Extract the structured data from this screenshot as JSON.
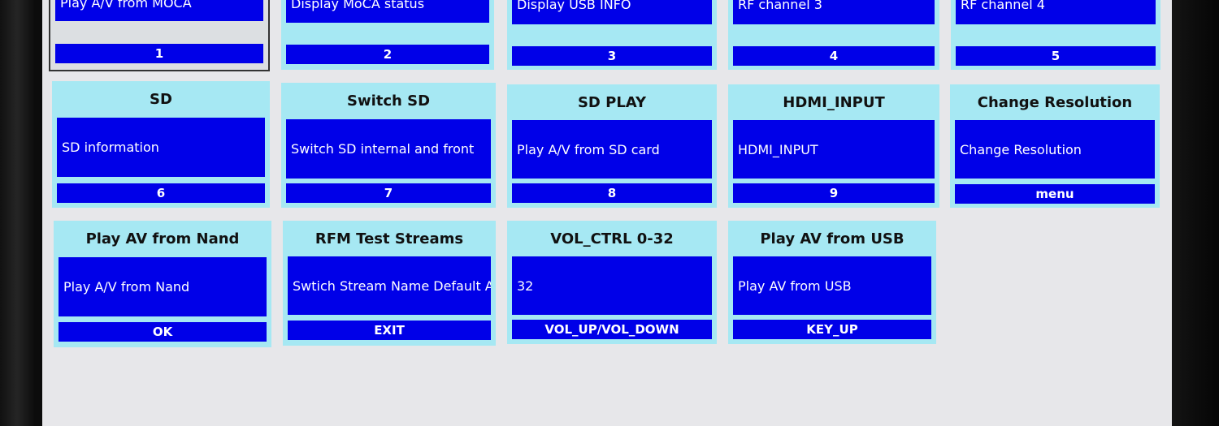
{
  "rows": [
    [
      {
        "title": "",
        "desc": "Play A/V from MOCA",
        "key": "1"
      },
      {
        "title": "",
        "desc": "Display MoCA status",
        "key": "2"
      },
      {
        "title": "",
        "desc": "Display USB INFO",
        "key": "3"
      },
      {
        "title": "",
        "desc": "RF channel 3",
        "key": "4"
      },
      {
        "title": "",
        "desc": "RF channel 4",
        "key": "5"
      }
    ],
    [
      {
        "title": "SD",
        "desc": "SD information",
        "key": "6"
      },
      {
        "title": "Switch SD",
        "desc": "Switch SD internal and front",
        "key": "7"
      },
      {
        "title": "SD PLAY",
        "desc": "Play A/V from SD card",
        "key": "8"
      },
      {
        "title": "HDMI_INPUT",
        "desc": "HDMI_INPUT",
        "key": "9"
      },
      {
        "title": "Change Resolution",
        "desc": "Change Resolution",
        "key": "menu"
      }
    ],
    [
      {
        "title": "Play AV from Nand",
        "desc": "Play A/V from Nand",
        "key": "OK"
      },
      {
        "title": "RFM Test Streams",
        "desc": "Swtich Stream Name Default A",
        "key": "EXIT"
      },
      {
        "title": "VOL_CTRL 0-32",
        "desc": "32",
        "key": "VOL_UP/VOL_DOWN"
      },
      {
        "title": "Play AV from USB",
        "desc": "Play AV from USB",
        "key": "KEY_UP"
      }
    ]
  ],
  "colors": {
    "tile_bg": "#a6e8f3",
    "button_blue": "#0000e8",
    "screen_bg": "#e7e7ea"
  }
}
